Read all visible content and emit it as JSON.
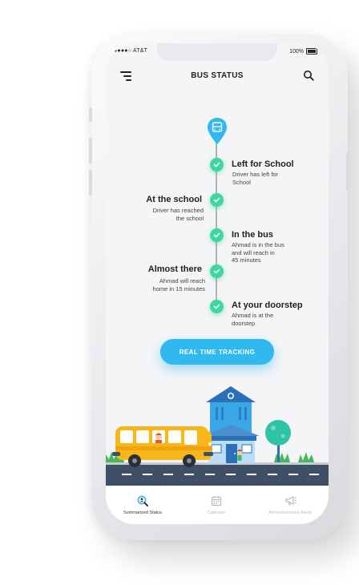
{
  "status_bar": {
    "carrier": "●●●●○ AT&T",
    "battery": "100%"
  },
  "header": {
    "title": "BUS STATUS"
  },
  "timeline": [
    {
      "title": "Left for School",
      "desc": [
        "Driver has left for",
        "School"
      ],
      "side": "right"
    },
    {
      "title": "At the school",
      "desc": [
        "Driver has reached",
        "the school"
      ],
      "side": "left"
    },
    {
      "title": "In the bus",
      "desc": [
        "Ahmad is in the bus",
        "and will reach in",
        "45 minutes"
      ],
      "side": "right"
    },
    {
      "title": "Almost there",
      "desc": [
        "Ahmad will reach",
        "home in 15 minutes"
      ],
      "side": "left"
    },
    {
      "title": "At your doorstep",
      "desc": [
        "Ahmad is at the",
        "doorstep"
      ],
      "side": "right"
    }
  ],
  "cta": {
    "label": "REAL TIME TRACKING"
  },
  "tabs": [
    {
      "label": "Summarized Status",
      "icon": "search-person-icon",
      "active": true
    },
    {
      "label": "Calendar",
      "icon": "calendar-icon",
      "active": false
    },
    {
      "label": "Announcement/ Alerts",
      "icon": "megaphone-icon",
      "active": false
    }
  ],
  "colors": {
    "accent": "#2fb9f0",
    "check": "#3fd6a0",
    "bus": "#f7b71b",
    "house": "#3aa8e6"
  }
}
